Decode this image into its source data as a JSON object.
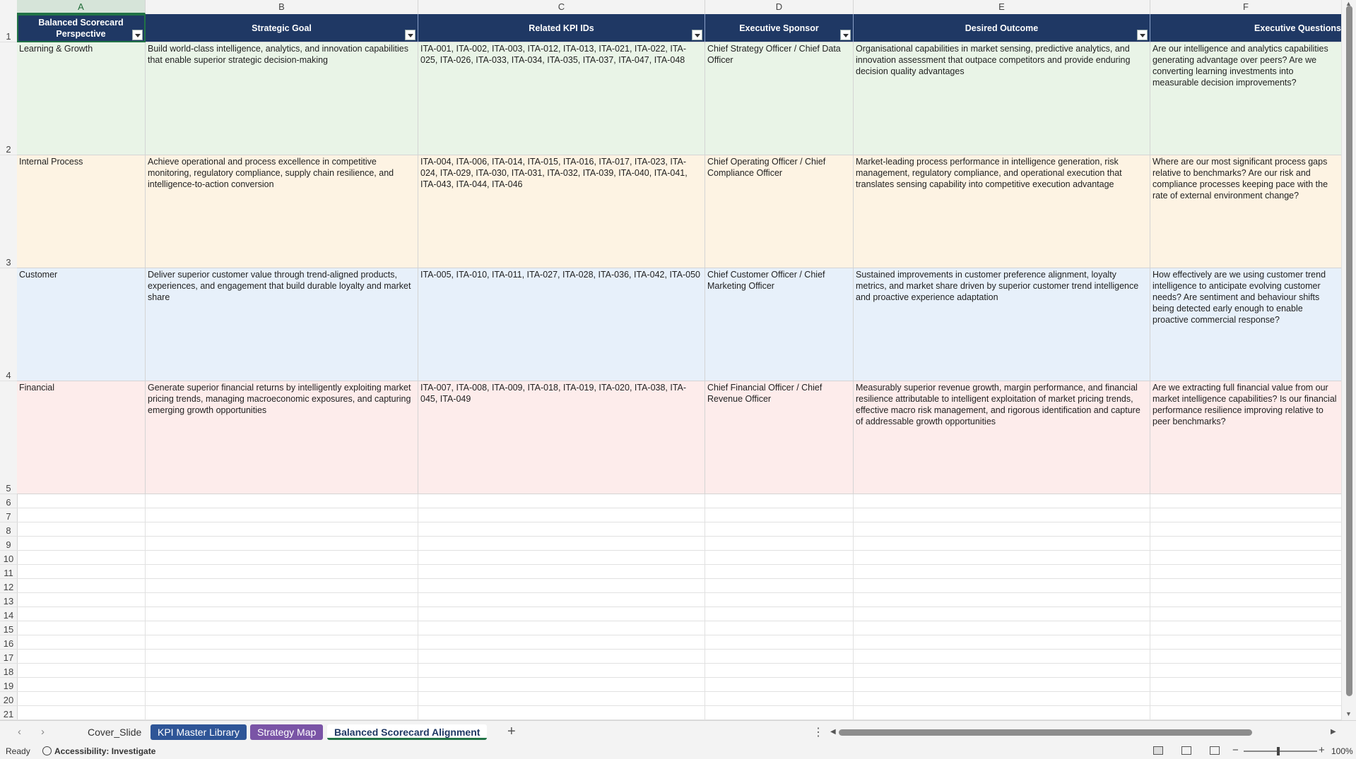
{
  "columns": [
    "A",
    "B",
    "C",
    "D",
    "E",
    "F"
  ],
  "rows": [
    "1",
    "2",
    "3",
    "4",
    "5",
    "6",
    "7",
    "8",
    "9",
    "10",
    "11",
    "12",
    "13",
    "14",
    "15",
    "16",
    "17",
    "18",
    "19",
    "20",
    "21"
  ],
  "headers": {
    "a": "Balanced Scorecard Perspective",
    "b": "Strategic Goal",
    "c": "Related KPI IDs",
    "d": "Executive Sponsor",
    "e": "Desired Outcome",
    "f": "Executive Questions"
  },
  "records": [
    {
      "perspective": "Learning & Growth",
      "goal": "Build world-class intelligence, analytics, and innovation capabilities that enable superior strategic decision-making",
      "kpis": "ITA-001, ITA-002, ITA-003, ITA-012, ITA-013, ITA-021, ITA-022, ITA-025, ITA-026, ITA-033, ITA-034, ITA-035, ITA-037, ITA-047, ITA-048",
      "sponsor": "Chief Strategy Officer / Chief Data Officer",
      "outcome": "Organisational capabilities in market sensing, predictive analytics, and innovation assessment that outpace competitors and provide enduring decision quality advantages",
      "questions": "Are our intelligence and analytics capabilities generating advantage over peers? Are we converting learning investments into measurable decision improvements?"
    },
    {
      "perspective": "Internal Process",
      "goal": "Achieve operational and process excellence in competitive monitoring, regulatory compliance, supply chain resilience, and intelligence-to-action conversion",
      "kpis": "ITA-004, ITA-006, ITA-014, ITA-015, ITA-016, ITA-017, ITA-023, ITA-024, ITA-029, ITA-030, ITA-031, ITA-032, ITA-039, ITA-040, ITA-041, ITA-043, ITA-044, ITA-046",
      "sponsor": "Chief Operating Officer / Chief Compliance Officer",
      "outcome": "Market-leading process performance in intelligence generation, risk management, regulatory compliance, and operational execution that translates sensing capability into competitive execution advantage",
      "questions": "Where are our most significant process gaps relative to benchmarks? Are our risk and compliance processes keeping pace with the rate of external environment change?"
    },
    {
      "perspective": "Customer",
      "goal": "Deliver superior customer value through trend-aligned products, experiences, and engagement that build durable loyalty and market share",
      "kpis": "ITA-005, ITA-010, ITA-011, ITA-027, ITA-028, ITA-036, ITA-042, ITA-050",
      "sponsor": "Chief Customer Officer / Chief Marketing Officer",
      "outcome": "Sustained improvements in customer preference alignment, loyalty metrics, and market share driven by superior customer trend intelligence and proactive experience adaptation",
      "questions": "How effectively are we using customer trend intelligence to anticipate evolving customer needs? Are sentiment and behaviour shifts being detected early enough to enable proactive commercial response?"
    },
    {
      "perspective": "Financial",
      "goal": "Generate superior financial returns by intelligently exploiting market pricing trends, managing macroeconomic exposures, and capturing emerging growth opportunities",
      "kpis": "ITA-007, ITA-008, ITA-009, ITA-018, ITA-019, ITA-020, ITA-038, ITA-045, ITA-049",
      "sponsor": "Chief Financial Officer / Chief Revenue Officer",
      "outcome": "Measurably superior revenue growth, margin performance, and financial resilience attributable to intelligent exploitation of market pricing trends, effective macro risk management, and rigorous identification and capture of addressable growth opportunities",
      "questions": "Are we extracting full financial value from our market intelligence capabilities? Is our financial performance resilience improving relative to peer benchmarks?"
    }
  ],
  "row_colors": [
    "#e9f4e7",
    "#fdf3e3",
    "#e7f0fa",
    "#fdeceb"
  ],
  "header_color": "#1f3864",
  "tabs": [
    {
      "label": "Cover_Slide",
      "style": "plain"
    },
    {
      "label": "KPI Master Library",
      "style": "blue"
    },
    {
      "label": "Strategy Map",
      "style": "purple"
    },
    {
      "label": "Balanced Scorecard Alignment",
      "style": "active"
    }
  ],
  "status": {
    "ready": "Ready",
    "accessibility": "Accessibility: Investigate",
    "zoom": "100%"
  }
}
